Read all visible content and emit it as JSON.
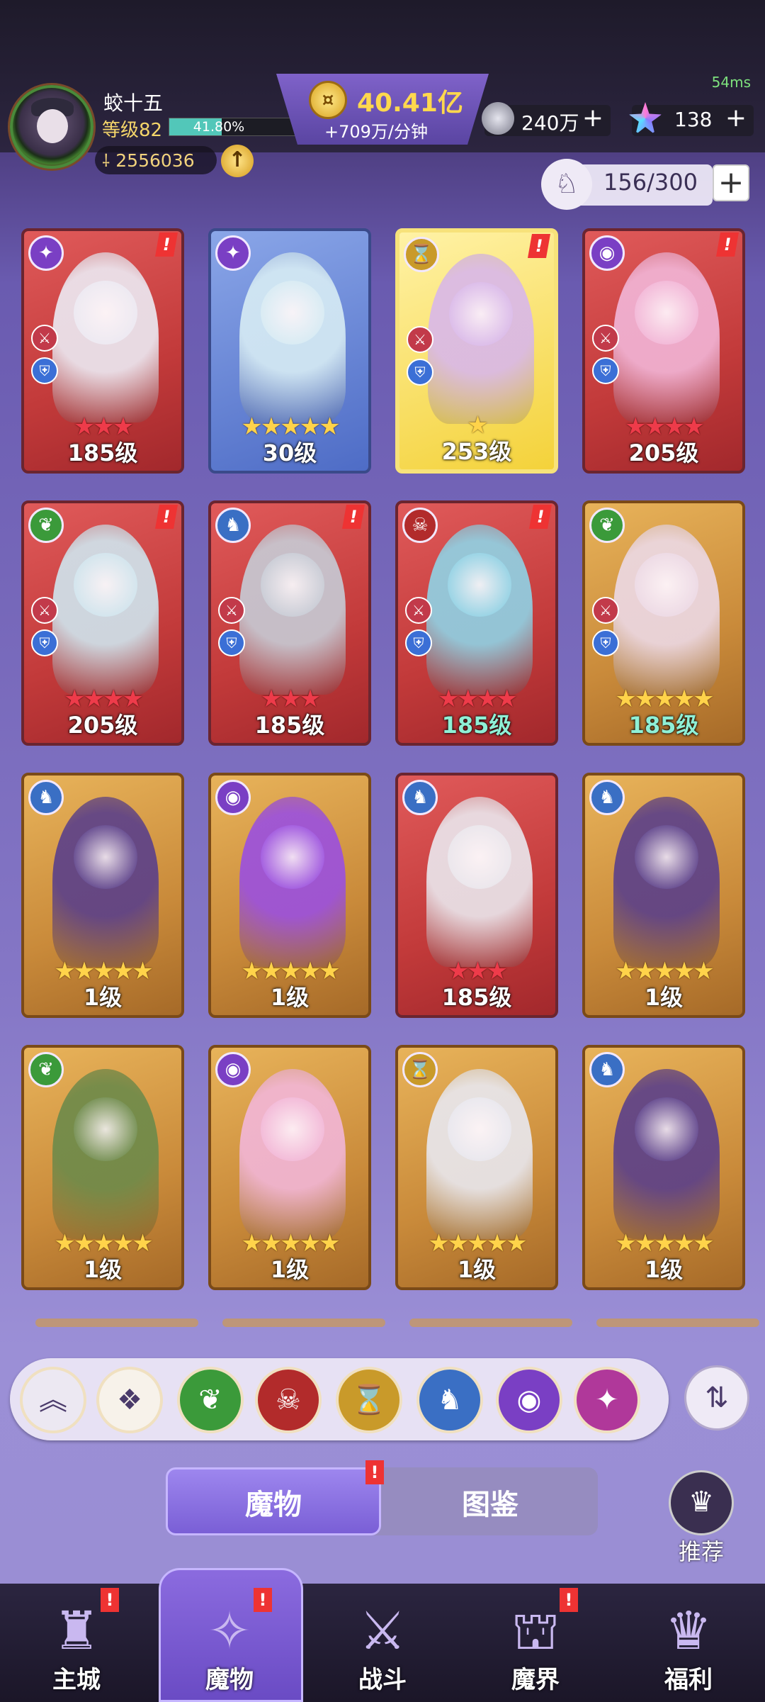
{
  "status": {
    "latency": "54ms"
  },
  "player": {
    "name": "蛟十五",
    "level_label": "等级82",
    "xp_percent": "41.80%",
    "xp_fraction": 0.418,
    "power": "2556036",
    "power_icon": "sword-icon",
    "upgrade_icon": "arrow-up-icon"
  },
  "currency": {
    "gold": "40.41亿",
    "gold_rate": "+709万/分钟",
    "gold_icon": "coin-icon",
    "silver": "240万",
    "gems": "138",
    "plus": "+"
  },
  "capacity": {
    "value": "156/300",
    "icon": "monster-bag-icon",
    "plus": "+"
  },
  "colors": {
    "accent": "#7a5fd6",
    "alert": "#e33333",
    "star_gold": "#ffd34a",
    "star_red": "#ee3b4a",
    "level_teal": "#8ff0d6"
  },
  "alert_glyph": "!",
  "cards": [
    {
      "frame": "red",
      "element": "purple",
      "glyph": "✦",
      "stars": "★★★",
      "star_color": "red",
      "level": "185级",
      "alert": true,
      "tags": true,
      "art": "#ecebf4"
    },
    {
      "frame": "blue",
      "element": "purple",
      "glyph": "✦",
      "stars": "★★★★★",
      "star_color": "gold",
      "level": "30级",
      "alert": false,
      "tags": false,
      "art": "#d7ecf4"
    },
    {
      "frame": "yellow",
      "element": "gold",
      "glyph": "⌛",
      "stars": "★",
      "star_color": "gold",
      "level": "253级",
      "alert": true,
      "tags": true,
      "art": "#d8b7ea"
    },
    {
      "frame": "red",
      "element": "purple",
      "glyph": "◉",
      "stars": "★★★★",
      "star_color": "red",
      "level": "205级",
      "alert": true,
      "tags": true,
      "art": "#f2b6d8"
    },
    {
      "frame": "red",
      "element": "green",
      "glyph": "❦",
      "stars": "★★★★",
      "star_color": "red",
      "level": "205级",
      "alert": true,
      "tags": true,
      "art": "#cfe6ef"
    },
    {
      "frame": "red",
      "element": "blue",
      "glyph": "♞",
      "stars": "★★★",
      "star_color": "red",
      "level": "185级",
      "alert": true,
      "tags": true,
      "art": "#c6ccd6"
    },
    {
      "frame": "red",
      "element": "red",
      "glyph": "☠",
      "stars": "★★★★",
      "star_color": "red",
      "level": "185级",
      "level_color": "teal",
      "alert": true,
      "tags": true,
      "art": "#8fd3e6"
    },
    {
      "frame": "gold",
      "element": "green",
      "glyph": "❦",
      "stars": "★★★★★",
      "star_color": "gold",
      "level": "185级",
      "level_color": "teal",
      "alert": false,
      "tags": true,
      "art": "#ecd9e6"
    },
    {
      "frame": "gold",
      "element": "blue",
      "glyph": "♞",
      "stars": "★★★★★",
      "star_color": "gold",
      "level": "1级",
      "alert": false,
      "tags": false,
      "art": "#5a3f8a"
    },
    {
      "frame": "gold",
      "element": "purple",
      "glyph": "◉",
      "stars": "★★★★★",
      "star_color": "gold",
      "level": "1级",
      "alert": false,
      "tags": false,
      "art": "#9a4fe0"
    },
    {
      "frame": "red",
      "element": "blue",
      "glyph": "♞",
      "stars": "★★★",
      "star_color": "red",
      "level": "185级",
      "alert": false,
      "tags": false,
      "art": "#eae8ee"
    },
    {
      "frame": "gold",
      "element": "blue",
      "glyph": "♞",
      "stars": "★★★★★",
      "star_color": "gold",
      "level": "1级",
      "alert": false,
      "tags": false,
      "art": "#5a3f8a"
    },
    {
      "frame": "gold",
      "element": "green",
      "glyph": "❦",
      "stars": "★★★★★",
      "star_color": "gold",
      "level": "1级",
      "alert": false,
      "tags": false,
      "art": "#6c8a4a"
    },
    {
      "frame": "gold",
      "element": "purple",
      "glyph": "◉",
      "stars": "★★★★★",
      "star_color": "gold",
      "level": "1级",
      "alert": false,
      "tags": false,
      "art": "#f2b6d8"
    },
    {
      "frame": "gold",
      "element": "gold",
      "glyph": "⌛",
      "stars": "★★★★★",
      "star_color": "gold",
      "level": "1级",
      "alert": false,
      "tags": false,
      "art": "#e8e8f0"
    },
    {
      "frame": "gold",
      "element": "blue",
      "glyph": "♞",
      "stars": "★★★★★",
      "star_color": "gold",
      "level": "1级",
      "alert": false,
      "tags": false,
      "art": "#5a3f8a"
    }
  ],
  "filters": [
    {
      "name": "collapse",
      "icon": "chevron-up-icon",
      "glyph": "︽",
      "color": "#ece8f2"
    },
    {
      "name": "all",
      "icon": "all-elements-icon",
      "glyph": "❖",
      "color": "#f7f2ea"
    },
    {
      "name": "nature",
      "icon": "leaf-icon",
      "glyph": "❦",
      "color": "#3b9a3a"
    },
    {
      "name": "demon",
      "icon": "demon-skull-icon",
      "glyph": "☠",
      "color": "#b22b2b"
    },
    {
      "name": "time",
      "icon": "hourglass-icon",
      "glyph": "⌛",
      "color": "#c99a2a"
    },
    {
      "name": "dragon",
      "icon": "dragon-icon",
      "glyph": "♞",
      "color": "#3a6fc4"
    },
    {
      "name": "eye",
      "icon": "eye-icon",
      "glyph": "◉",
      "color": "#7a3fc4"
    },
    {
      "name": "chaos",
      "icon": "chaos-star-icon",
      "glyph": "✦",
      "color": "#b0389a"
    }
  ],
  "sort_icon": "sort-icon",
  "tabs": {
    "monsters": "魔物",
    "codex": "图鉴"
  },
  "recommend": {
    "label": "推荐",
    "icon": "recommend-icon"
  },
  "nav": [
    {
      "label": "主城",
      "icon": "castle-icon",
      "glyph": "♜",
      "alert": true
    },
    {
      "label": "魔物",
      "icon": "monster-flame-icon",
      "glyph": "✧",
      "alert": true,
      "active": true
    },
    {
      "label": "战斗",
      "icon": "battle-shield-icon",
      "glyph": "⚔",
      "alert": false
    },
    {
      "label": "魔界",
      "icon": "demon-realm-icon",
      "glyph": "⛫",
      "alert": true
    },
    {
      "label": "福利",
      "icon": "gift-chest-icon",
      "glyph": "♛",
      "alert": false
    }
  ]
}
